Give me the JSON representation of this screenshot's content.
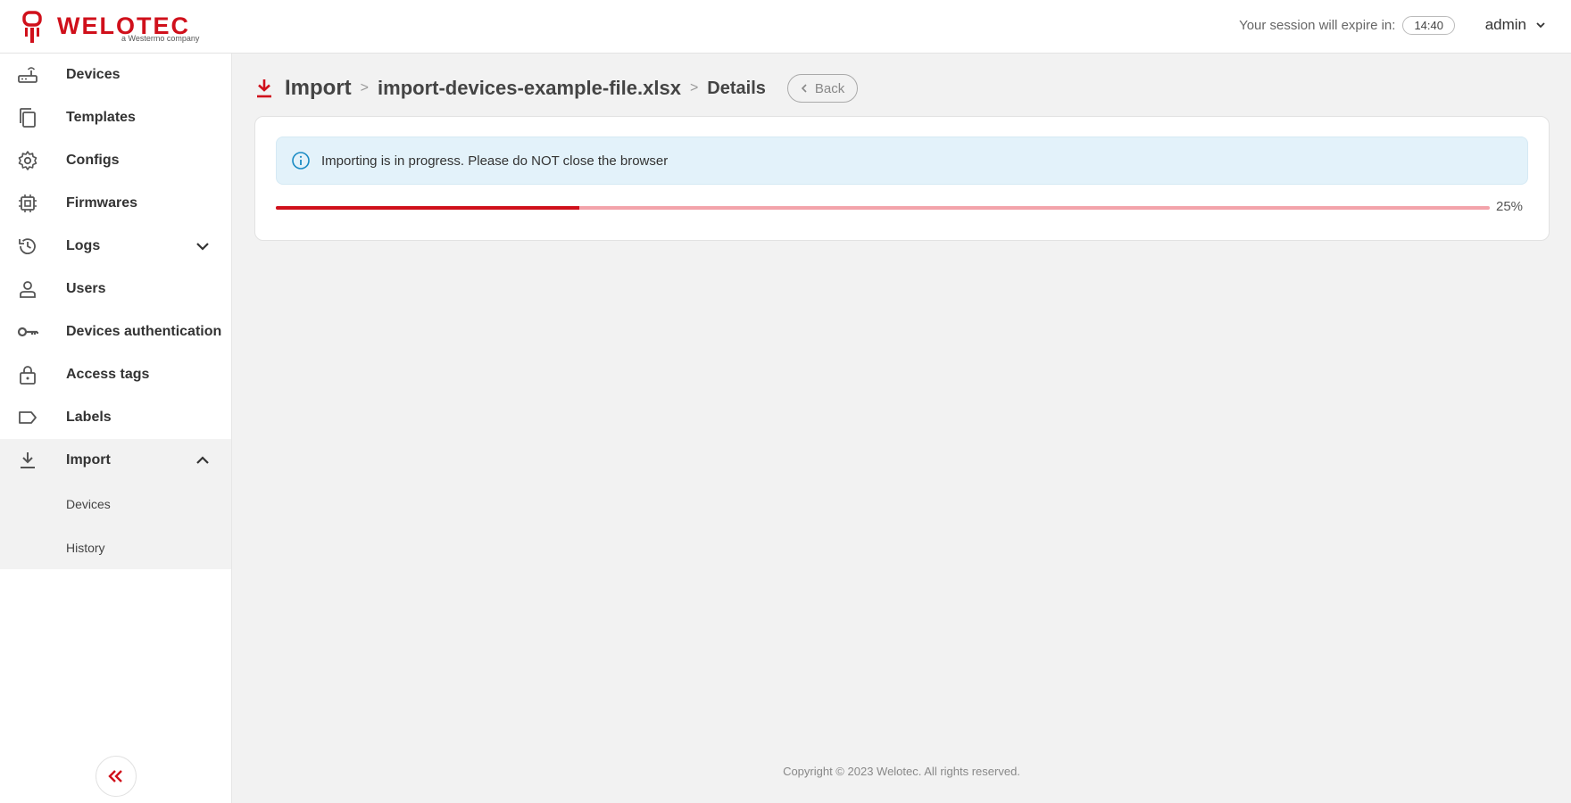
{
  "brand": {
    "name": "WELOTEC",
    "tagline": "a Westermo company",
    "accent_color": "#d0101b"
  },
  "header": {
    "session_label": "Your session will expire in:",
    "session_time": "14:40",
    "user_name": "admin"
  },
  "sidebar": {
    "items": [
      {
        "label": "Devices",
        "icon": "router-icon"
      },
      {
        "label": "Templates",
        "icon": "copy-icon"
      },
      {
        "label": "Configs",
        "icon": "gear-icon"
      },
      {
        "label": "Firmwares",
        "icon": "chip-icon"
      },
      {
        "label": "Logs",
        "icon": "history-icon"
      },
      {
        "label": "Users",
        "icon": "user-icon"
      },
      {
        "label": "Devices authentication",
        "icon": "key-icon"
      },
      {
        "label": "Access tags",
        "icon": "lock-icon"
      },
      {
        "label": "Labels",
        "icon": "label-icon"
      },
      {
        "label": "Import",
        "icon": "download-icon"
      }
    ],
    "import_subitems": [
      {
        "label": "Devices"
      },
      {
        "label": "History"
      }
    ]
  },
  "breadcrumb": {
    "root": "Import",
    "separator": ">",
    "file": "import-devices-example-file.xlsx",
    "current": "Details",
    "back_label": "Back"
  },
  "import_status": {
    "message": "Importing is in progress. Please do NOT close the browser",
    "progress_percent": 25,
    "progress_label": "25%"
  },
  "footer": {
    "copyright": "Copyright © 2023 Welotec. All rights reserved."
  }
}
